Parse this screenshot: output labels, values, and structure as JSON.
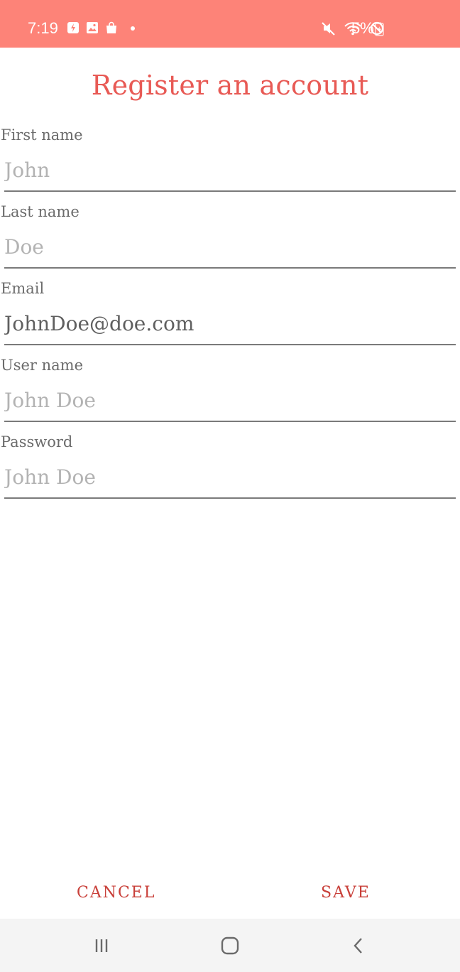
{
  "status_bar": {
    "time": "7:19",
    "battery_text": "5%",
    "left_icons": [
      "sync-icon",
      "image-icon",
      "shopping-bag-icon",
      "notification-dot"
    ],
    "right_icons": [
      "mute-icon",
      "wifi-icon",
      "do-not-disturb-icon",
      "battery-icon"
    ]
  },
  "title": "Register an account",
  "form": {
    "first_name": {
      "label": "First name",
      "value": "",
      "placeholder": "John"
    },
    "last_name": {
      "label": "Last name",
      "value": "",
      "placeholder": "Doe"
    },
    "email": {
      "label": "Email",
      "value": "JohnDoe@doe.com",
      "placeholder": ""
    },
    "user_name": {
      "label": "User name",
      "value": "",
      "placeholder": "John Doe"
    },
    "password": {
      "label": "Password",
      "value": "",
      "placeholder": "John Doe"
    }
  },
  "actions": {
    "cancel_label": "CANCEL",
    "save_label": "SAVE"
  },
  "nav_bar": {
    "icons": [
      "recents-icon",
      "home-icon",
      "back-icon"
    ]
  },
  "colors": {
    "status_bar": "#fd8378",
    "title": "#e85a55",
    "button_text": "#c9403a"
  }
}
